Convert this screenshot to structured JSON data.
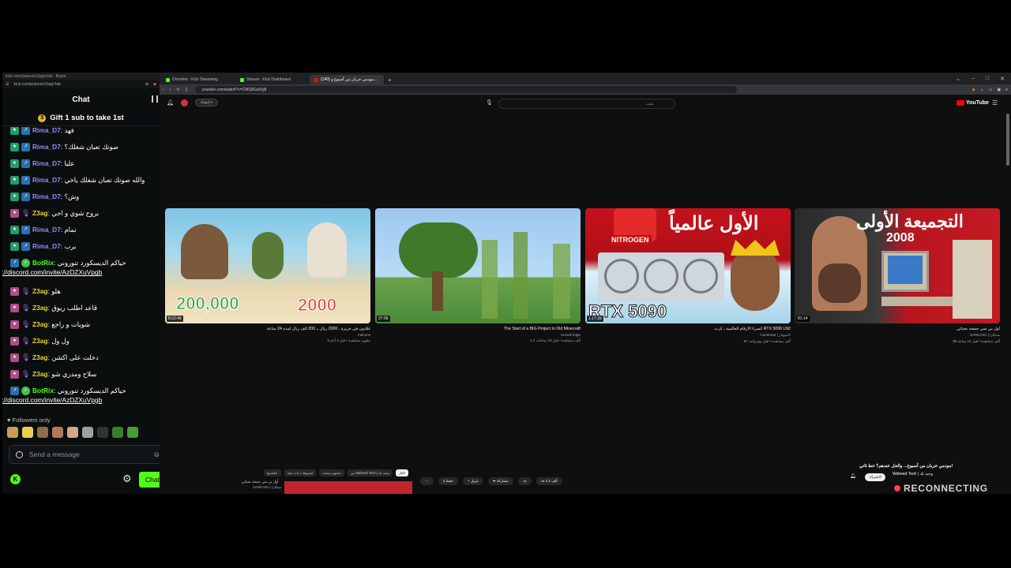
{
  "kick_window": {
    "title": "kick.com/popout/z3ag/chat - Brave",
    "url": "kick.com/popout/z3ag/chat",
    "chat_title": "Chat",
    "gift_banner": "Gift 1 sub to take 1st",
    "messages": [
      {
        "badges": [
          "sub",
          "kick"
        ],
        "user": "Rima_D7",
        "user_class": "rima",
        "text": "فهد"
      },
      {
        "badges": [
          "sub",
          "kick"
        ],
        "user": "Rima_D7",
        "user_class": "rima",
        "text": "صوتك تعبان شغلك؟"
      },
      {
        "badges": [
          "sub",
          "kick"
        ],
        "user": "Rima_D7",
        "user_class": "rima",
        "text": "عليا"
      },
      {
        "badges": [
          "sub",
          "kick"
        ],
        "user": "Rima_D7",
        "user_class": "rima",
        "text": "والله صوتك تعبان شغلك ياخي"
      },
      {
        "badges": [
          "sub",
          "kick"
        ],
        "user": "Rima_D7",
        "user_class": "rima",
        "text": "وش؟"
      },
      {
        "badges": [
          "sub2",
          "mic"
        ],
        "user": "Z3ag",
        "user_class": "z3ag",
        "text": "بروح شوي و اجي"
      },
      {
        "badges": [
          "sub",
          "kick"
        ],
        "user": "Rima_D7",
        "user_class": "rima",
        "text": "تمام"
      },
      {
        "badges": [
          "sub",
          "kick"
        ],
        "user": "Rima_D7",
        "user_class": "rima",
        "text": "برب"
      },
      {
        "badges": [
          "kick",
          "ver"
        ],
        "user": "BotRix",
        "user_class": "botrix",
        "text": "حياكم الديسكورد تنوروني",
        "link": "https://discord.com/invite/AzDZXuVpgb"
      },
      {
        "badges": [
          "sub2",
          "mic"
        ],
        "user": "Z3ag",
        "user_class": "z3ag",
        "text": "هلو"
      },
      {
        "badges": [
          "sub2",
          "mic"
        ],
        "user": "Z3ag",
        "user_class": "z3ag",
        "text": "قاعد اطلب ريوق"
      },
      {
        "badges": [
          "sub2",
          "mic"
        ],
        "user": "Z3ag",
        "user_class": "z3ag",
        "text": "شويات و راجع"
      },
      {
        "badges": [
          "sub2",
          "mic"
        ],
        "user": "Z3ag",
        "user_class": "z3ag",
        "text": "ول ول"
      },
      {
        "badges": [
          "sub2",
          "mic"
        ],
        "user": "Z3ag",
        "user_class": "z3ag",
        "text": "دخلت على اكشن"
      },
      {
        "badges": [
          "sub2",
          "mic"
        ],
        "user": "Z3ag",
        "user_class": "z3ag",
        "text": "سلاح ومدري شو"
      },
      {
        "badges": [
          "kick",
          "ver"
        ],
        "user": "BotRix",
        "user_class": "botrix",
        "text": "حياكم الديسكورد تنوروني",
        "link": "https://discord.com/invite/AzDZXuVpgb"
      }
    ],
    "followers_only": "Followers only",
    "input_placeholder": "Send a message",
    "chat_button": "Chat",
    "emote_colors": [
      "#c99c5a",
      "#e8d04a",
      "#8c6e4a",
      "#b07a5a",
      "#d0a88a",
      "#a0a0a0",
      "#333",
      "#3b7d2f",
      "#4a9c3a"
    ]
  },
  "browser": {
    "tabs": [
      {
        "label": "Dovolnet - Kick Streaming",
        "color": "#53fc18"
      },
      {
        "label": "Stream - Kick Dashboard",
        "color": "#53fc18"
      },
      {
        "label": "(140) مودمي خربان من أسبوع و...",
        "color": "#ff0000"
      }
    ],
    "url": "youtube.com/watch?v=CMQ8GqVyj8",
    "youtube": {
      "create_label": "إنشاء",
      "search_placeholder": "بحث",
      "logo_text": "YouTube",
      "videos": [
        {
          "duration": "8:22:46",
          "title": "غلادون في جزيرة ، 2000 ريال بـ 200 الف ريال لمدة 24 ساعة",
          "channel": "Falcons",
          "meta": "6 مليون مشاهدة • قبل 4 أيام",
          "overlay_left": "200,000",
          "overlay_right": "2000"
        },
        {
          "duration": "37:06",
          "title": "The Start of a BIG Project in Old Minecraft",
          "channel": "HorseFridge",
          "meta": "1.2 ألف مشاهدة • قبل 10 ساعات"
        },
        {
          "duration": "1:17:39",
          "title": "كسرنا الأرقام العالمية ، كرت RTX 5090 LN2",
          "channel": "Cambotar | كامبوتار",
          "meta": "97 ألف مشاهدة • قبل يوم واحد",
          "overlay_top": "الأول عالمياً",
          "overlay_bottom": "RTX 5090",
          "overlay_tag": "NITROGEN"
        },
        {
          "duration": "81:14",
          "title": "أول بي سي جمعته بحياتي",
          "channel": "SANKARA | سنكارا",
          "meta": "86 ألف مشاهدة • قبل 12 ساعة",
          "overlay_top": "التجميعة الأولى",
          "overlay_year": "2008"
        }
      ],
      "now_playing": {
        "title": "مودمي خربان من أسبوع... والحل عندهم؟ خط ثاني!",
        "channel": "Waheed Tech | وحيد تك",
        "subscribe": "الاشتراك",
        "like_count": "1.1 ألف",
        "chips": [
          "الكل",
          "من Waheed Tech | وحيد تك",
          "محتوى مشابه",
          "فيديوهات ذات صلة",
          "شاهدتها"
        ],
        "actions": [
          "مشاركة",
          "تنزيل",
          "حفظ"
        ],
        "next_title": "أول بي سي جمعته بحياتي",
        "next_channel": "SANKARA | سنكارا"
      }
    }
  },
  "overlay": {
    "reconnecting": "RECONNECTING"
  }
}
